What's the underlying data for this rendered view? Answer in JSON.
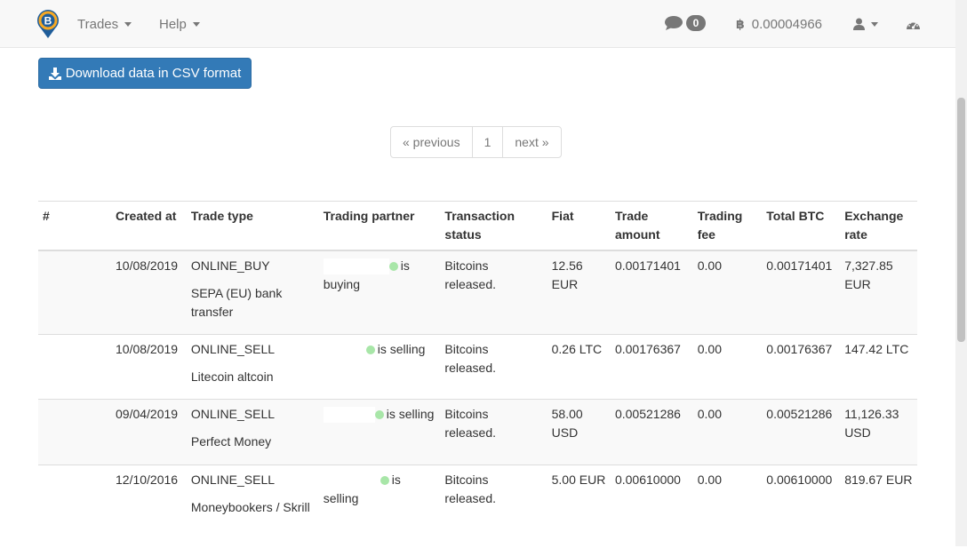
{
  "navbar": {
    "menus": [
      {
        "label": "Trades"
      },
      {
        "label": "Help"
      }
    ],
    "messages_count": "0",
    "btc_balance": "0.00004966",
    "colors": {
      "navbar_bg": "#f8f8f8",
      "text": "#777777"
    }
  },
  "actions": {
    "download_label": "Download data in CSV format",
    "button_color": "#337ab7"
  },
  "pagination": {
    "previous": "« previous",
    "current": "1",
    "next": "next »"
  },
  "table": {
    "headers": {
      "id": "#",
      "created_at": "Created at",
      "trade_type": "Trade type",
      "partner": "Trading partner",
      "status": "Transaction status",
      "fiat": "Fiat",
      "amount": "Trade amount",
      "fee": "Trading fee",
      "total": "Total BTC",
      "rate": "Exchange rate"
    },
    "rows": [
      {
        "created": "10/08/2019",
        "type": "ONLINE_BUY",
        "method": "SEPA (EU) bank transfer",
        "partner_action": "is buying",
        "status": "Bitcoins released.",
        "fiat": "12.56 EUR",
        "amount": "0.00171401",
        "fee": "0.00",
        "total": "0.00171401",
        "rate": "7,327.85 EUR"
      },
      {
        "created": "10/08/2019",
        "type": "ONLINE_SELL",
        "method": "Litecoin altcoin",
        "partner_action": "is selling",
        "status": "Bitcoins released.",
        "fiat": "0.26 LTC",
        "amount": "0.00176367",
        "fee": "0.00",
        "total": "0.00176367",
        "rate": "147.42 LTC"
      },
      {
        "created": "09/04/2019",
        "type": "ONLINE_SELL",
        "method": "Perfect Money",
        "partner_action": "is selling",
        "status": "Bitcoins released.",
        "fiat": "58.00 USD",
        "amount": "0.00521286",
        "fee": "0.00",
        "total": "0.00521286",
        "rate": "11,126.33 USD"
      },
      {
        "created": "12/10/2016",
        "type": "ONLINE_SELL",
        "method": "Moneybookers / Skrill",
        "partner_action": "is selling",
        "status": "Bitcoins released.",
        "fiat": "5.00 EUR",
        "amount": "0.00610000",
        "fee": "0.00",
        "total": "0.00610000",
        "rate": "819.67 EUR"
      }
    ]
  },
  "icons": {
    "logo": "bitcoin-logo-icon",
    "chat": "chat-bubble-icon",
    "btc": "bitcoin-sign-icon",
    "user": "user-icon",
    "dashboard": "dashboard-gauge-icon",
    "download": "download-icon",
    "online_dot_color": "#a8e6a8"
  }
}
